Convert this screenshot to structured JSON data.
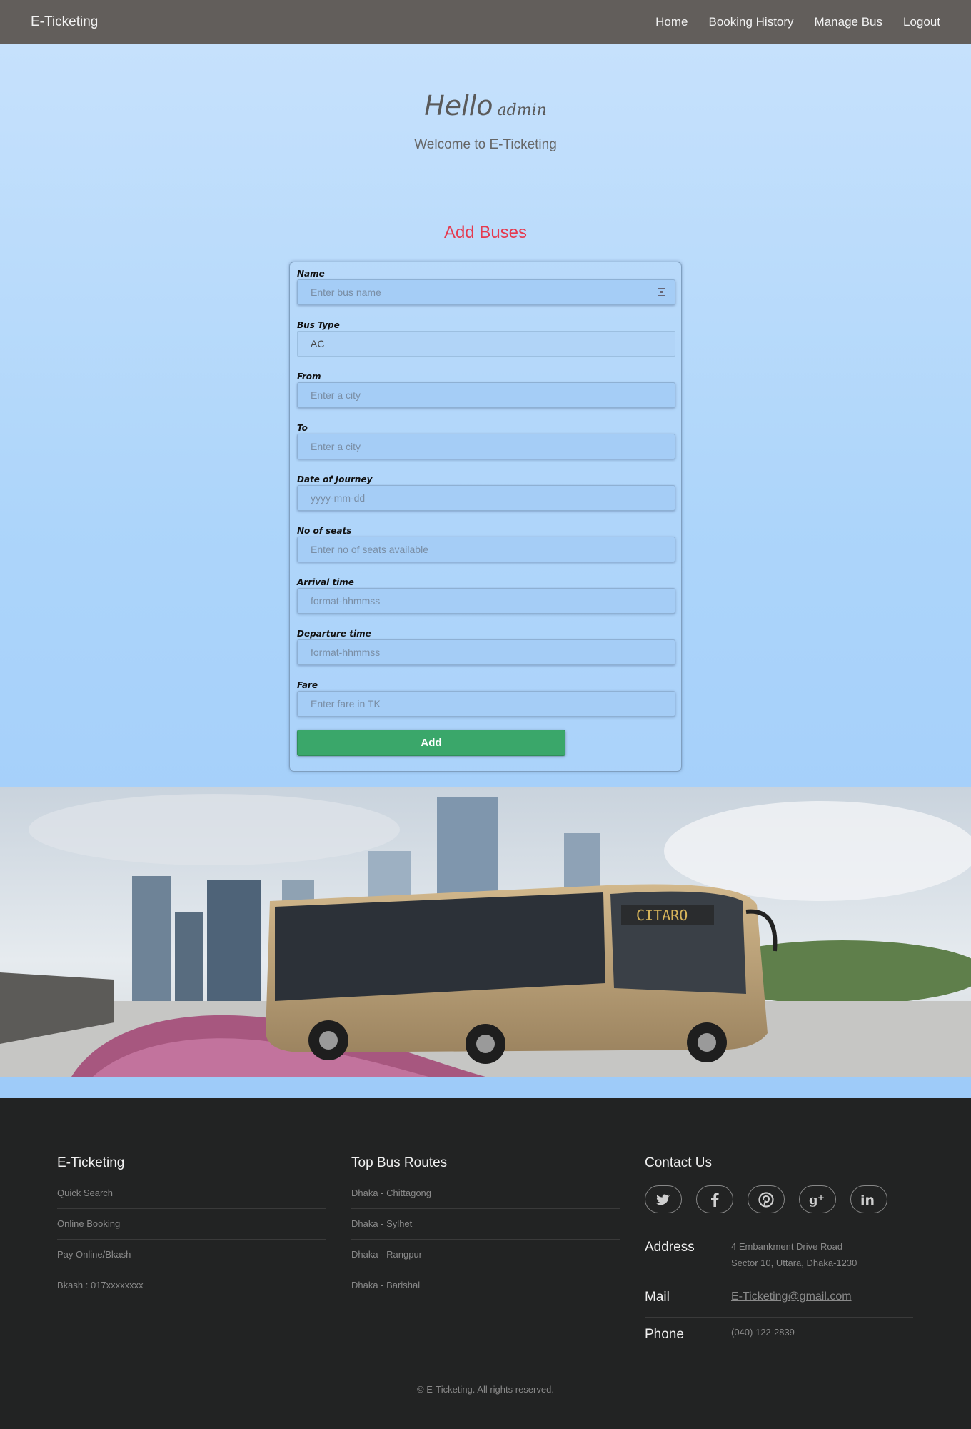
{
  "navbar": {
    "brand": "E-Ticketing",
    "links": [
      "Home",
      "Booking History",
      "Manage Bus",
      "Logout"
    ]
  },
  "hero": {
    "hello": "Hello",
    "user": "admin",
    "welcome": "Welcome to E-Ticketing"
  },
  "form": {
    "title": "Add Buses",
    "fields": {
      "name": {
        "label": "Name",
        "placeholder": "Enter bus name"
      },
      "bus_type": {
        "label": "Bus Type",
        "value": "AC"
      },
      "from": {
        "label": "From",
        "placeholder": "Enter a city"
      },
      "to": {
        "label": "To",
        "placeholder": "Enter a city"
      },
      "date": {
        "label": "Date of Journey",
        "placeholder": "yyyy-mm-dd"
      },
      "seats": {
        "label": "No of seats",
        "placeholder": "Enter no of seats available"
      },
      "arrival": {
        "label": "Arrival time",
        "placeholder": "format-hhmmss"
      },
      "departure": {
        "label": "Departure time",
        "placeholder": "format-hhmmss"
      },
      "fare": {
        "label": "Fare",
        "placeholder": "Enter fare in TK"
      }
    },
    "submit_label": "Add"
  },
  "banner": {
    "bus_sign": "CITARO"
  },
  "footer": {
    "col1": {
      "title": "E-Ticketing",
      "items": [
        "Quick Search",
        "Online Booking",
        "Pay Online/Bkash",
        "Bkash : 017xxxxxxxx"
      ]
    },
    "col2": {
      "title": "Top Bus Routes",
      "items": [
        "Dhaka - Chittagong",
        "Dhaka - Sylhet",
        "Dhaka - Rangpur",
        "Dhaka - Barishal"
      ]
    },
    "col3": {
      "title": "Contact Us",
      "socials": [
        "twitter-icon",
        "facebook-icon",
        "pinterest-icon",
        "google-plus-icon",
        "linkedin-icon"
      ],
      "address_label": "Address",
      "address_line1": "4 Embankment Drive Road",
      "address_line2": "Sector 10, Uttara, Dhaka-1230",
      "mail_label": "Mail",
      "mail_value": "E-Ticketing@gmail.com",
      "phone_label": "Phone",
      "phone_value": "(040) 122-2839"
    },
    "copyright": "© E-Ticketing. All rights reserved."
  },
  "colors": {
    "navbar_bg": "#625e5b",
    "title_red": "#e53a4f",
    "button_green": "#3aa76a",
    "footer_bg": "#222323"
  }
}
